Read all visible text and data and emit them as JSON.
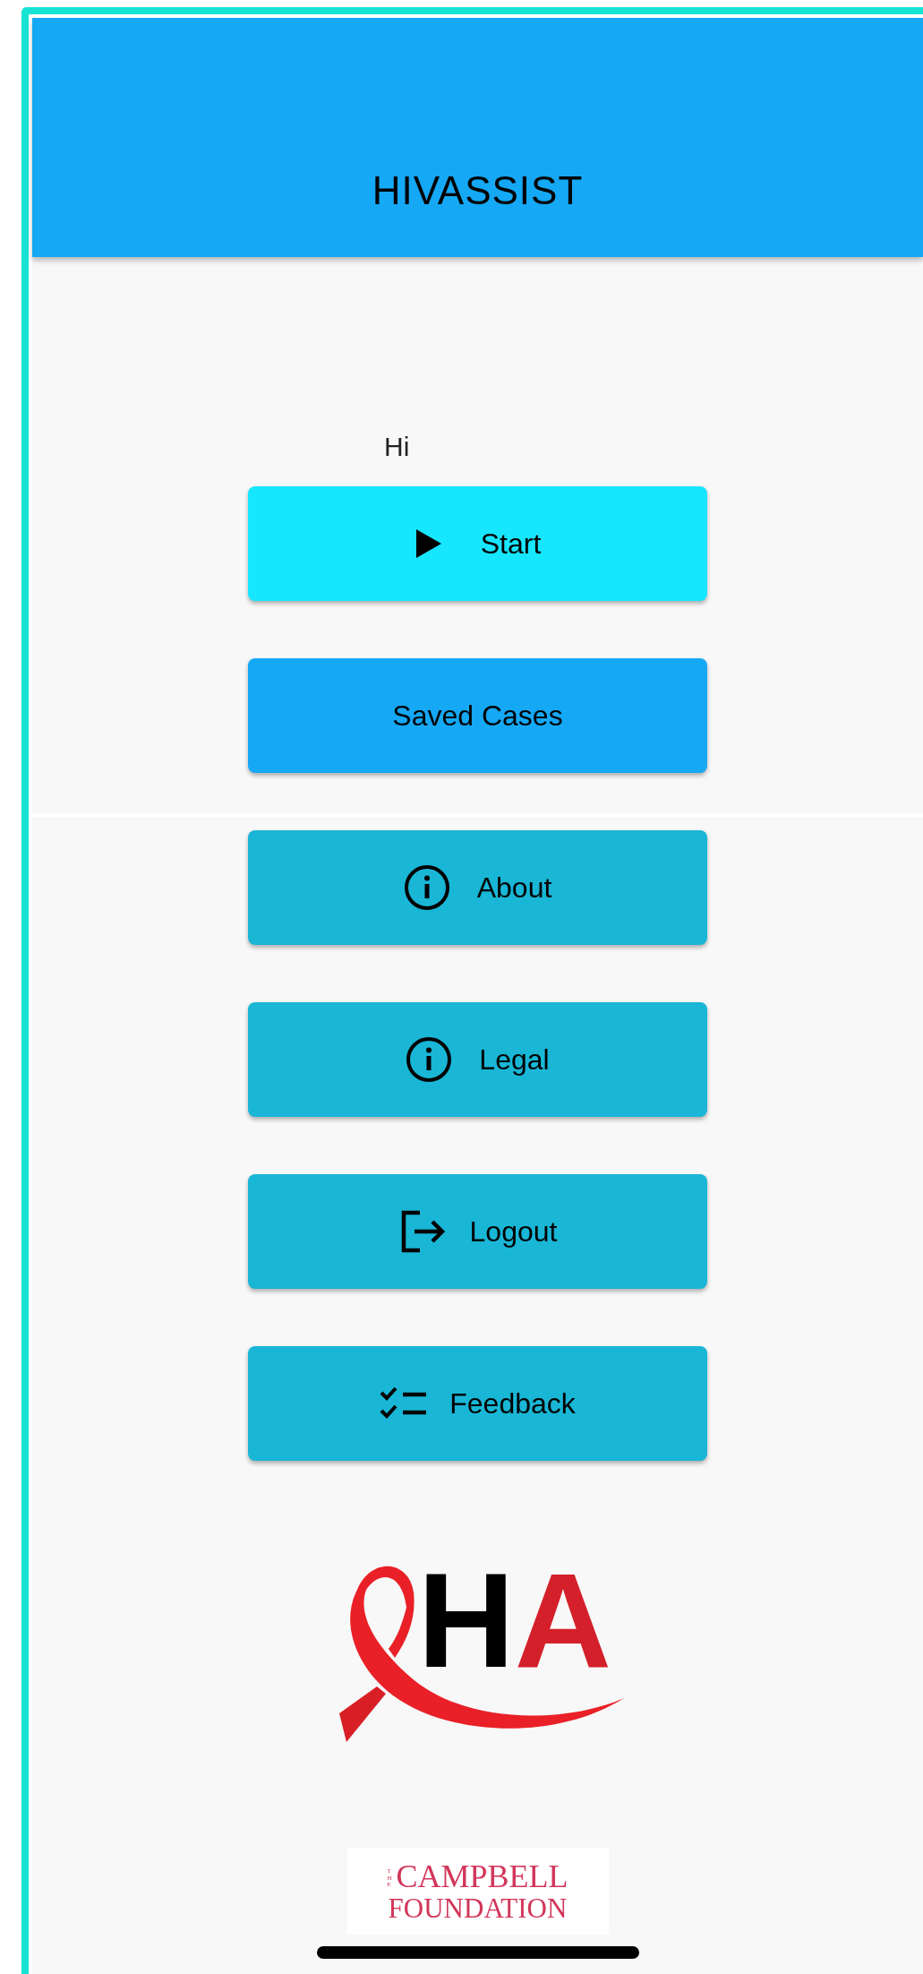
{
  "header": {
    "title": "HIVASSIST"
  },
  "greeting": "Hi",
  "buttons": [
    {
      "label": "Start",
      "kind": "play"
    },
    {
      "label": "Saved Cases",
      "kind": "plain"
    },
    {
      "label": "About",
      "kind": "info"
    },
    {
      "label": "Legal",
      "kind": "info"
    },
    {
      "label": "Logout",
      "kind": "logout"
    },
    {
      "label": "Feedback",
      "kind": "checklist"
    }
  ],
  "app_logo": {
    "letter_1": "H",
    "letter_2": "A"
  },
  "sponsor_logo": {
    "prefix": "THE",
    "line_1": "CAMPBELL",
    "line_2": "FOUNDATION"
  }
}
